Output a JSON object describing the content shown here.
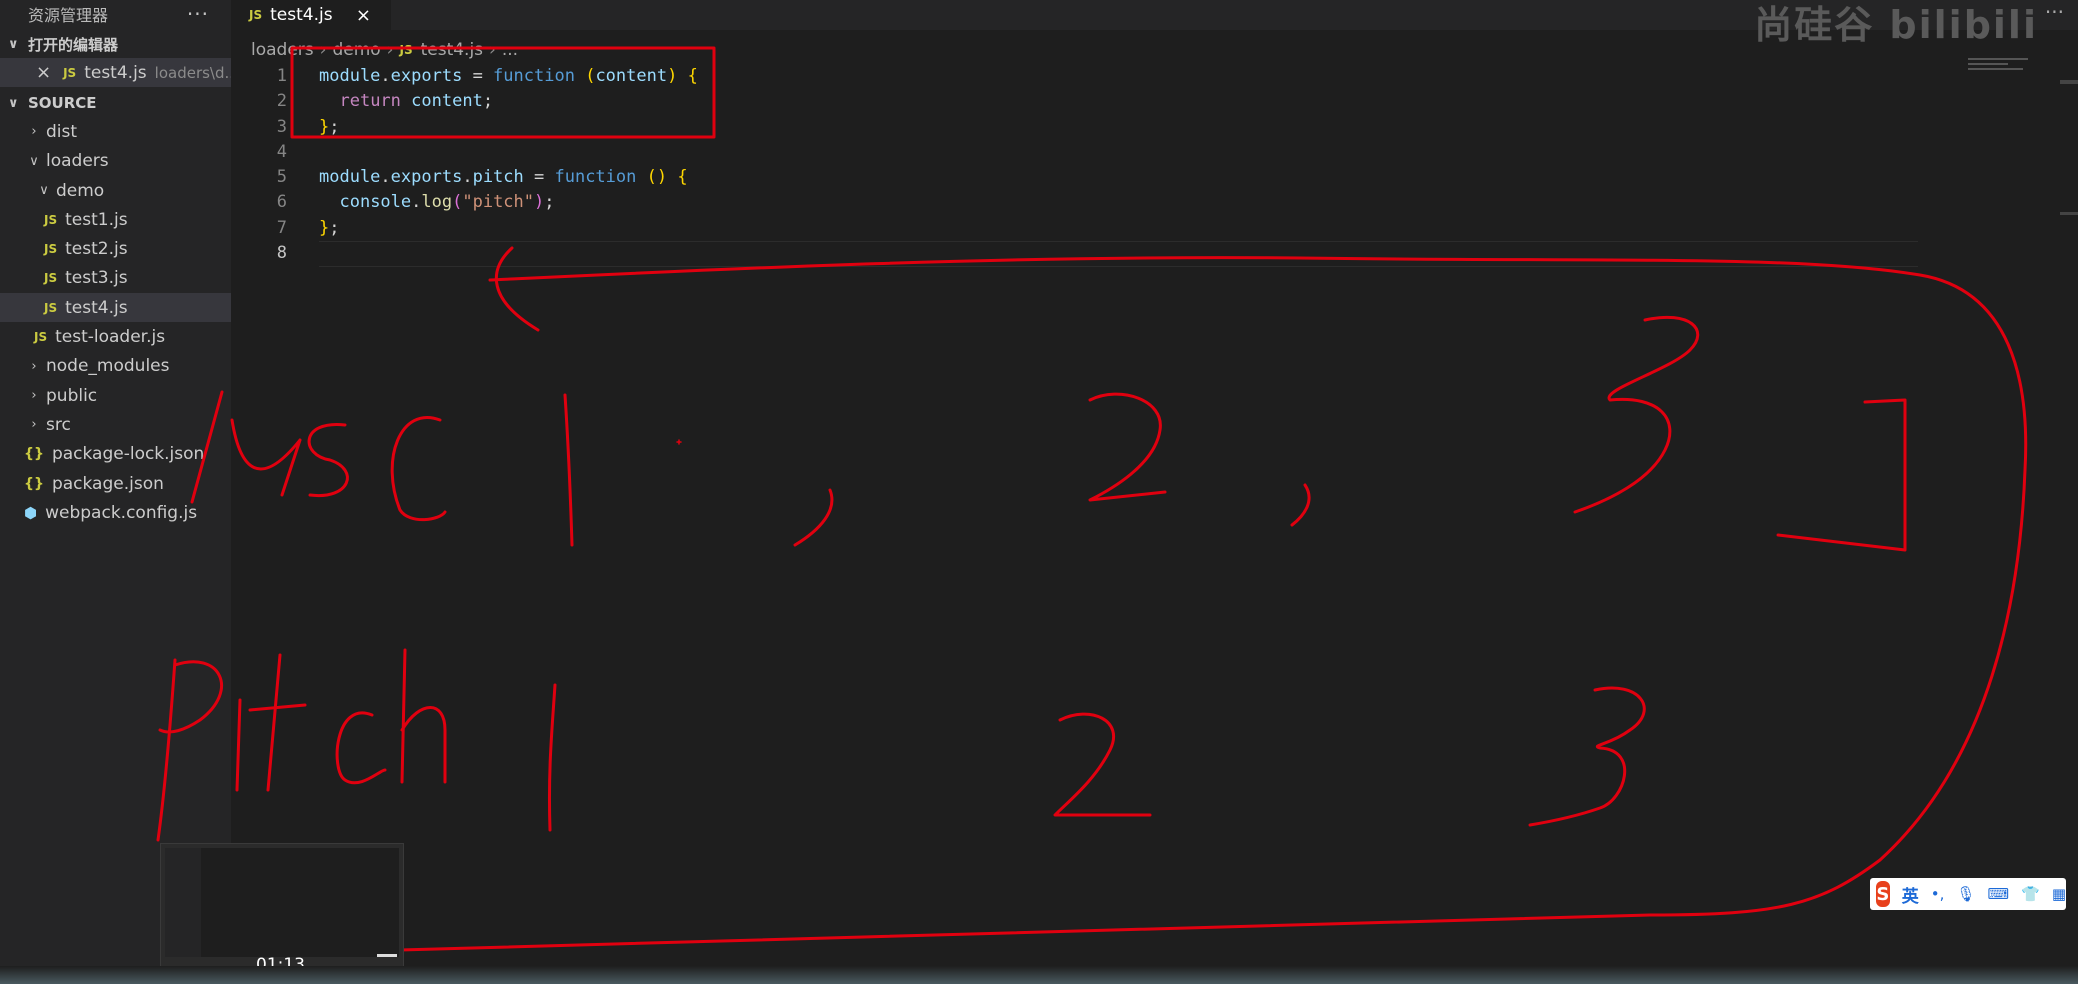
{
  "sidebar": {
    "title": "资源管理器",
    "more": "···",
    "open_editors_label": "打开的编辑器",
    "open_editor": {
      "name": "test4.js",
      "path": "loaders\\d..."
    },
    "project_label": "SOURCE",
    "tree": [
      {
        "label": "dist",
        "kind": "folder",
        "state": "collapsed",
        "depth": 1
      },
      {
        "label": "loaders",
        "kind": "folder",
        "state": "expanded",
        "depth": 1
      },
      {
        "label": "demo",
        "kind": "folder",
        "state": "expanded",
        "depth": 2
      },
      {
        "label": "test1.js",
        "kind": "js",
        "depth": 3
      },
      {
        "label": "test2.js",
        "kind": "js",
        "depth": 3
      },
      {
        "label": "test3.js",
        "kind": "js",
        "depth": 3
      },
      {
        "label": "test4.js",
        "kind": "js",
        "depth": 3,
        "selected": true
      },
      {
        "label": "test-loader.js",
        "kind": "js",
        "depth": 2
      },
      {
        "label": "node_modules",
        "kind": "folder",
        "state": "collapsed",
        "depth": 1
      },
      {
        "label": "public",
        "kind": "folder",
        "state": "collapsed",
        "depth": 1
      },
      {
        "label": "src",
        "kind": "folder",
        "state": "collapsed",
        "depth": 1
      },
      {
        "label": "package-lock.json",
        "kind": "json",
        "depth": 1
      },
      {
        "label": "package.json",
        "kind": "json",
        "depth": 1
      },
      {
        "label": "webpack.config.js",
        "kind": "webpack",
        "depth": 1
      }
    ]
  },
  "tab": {
    "label": "test4.js",
    "icon": "JS"
  },
  "watermark": "尚硅谷 bilibili",
  "breadcrumb": [
    "loaders",
    "demo",
    "test4.js",
    "..."
  ],
  "editor": {
    "line_numbers": [
      "1",
      "2",
      "3",
      "4",
      "5",
      "6",
      "7",
      "8"
    ],
    "lines": [
      [
        [
          "module",
          "k-var"
        ],
        [
          ".",
          "k-op"
        ],
        [
          "exports",
          "k-var"
        ],
        [
          " = ",
          "k-op"
        ],
        [
          "function",
          "k-fn"
        ],
        [
          " ",
          "k-op"
        ],
        [
          "(",
          "k-br"
        ],
        [
          "content",
          "k-var"
        ],
        [
          ")",
          "k-br"
        ],
        [
          " ",
          "k-op"
        ],
        [
          "{",
          "k-br"
        ]
      ],
      [
        [
          "  ",
          "k-op"
        ],
        [
          "return",
          "k-ret"
        ],
        [
          " ",
          "k-op"
        ],
        [
          "content",
          "k-var"
        ],
        [
          ";",
          "k-op"
        ]
      ],
      [
        [
          "}",
          "k-br"
        ],
        [
          ";",
          "k-op"
        ]
      ],
      [],
      [
        [
          "module",
          "k-var"
        ],
        [
          ".",
          "k-op"
        ],
        [
          "exports",
          "k-var"
        ],
        [
          ".",
          "k-op"
        ],
        [
          "pitch",
          "k-var"
        ],
        [
          " = ",
          "k-op"
        ],
        [
          "function",
          "k-fn"
        ],
        [
          " ",
          "k-op"
        ],
        [
          "()",
          "k-br"
        ],
        [
          " ",
          "k-op"
        ],
        [
          "{",
          "k-br"
        ]
      ],
      [
        [
          "  ",
          "k-op"
        ],
        [
          "console",
          "k-var"
        ],
        [
          ".",
          "k-op"
        ],
        [
          "log",
          "k-call"
        ],
        [
          "(",
          "k-br2"
        ],
        [
          "\"pitch\"",
          "k-str"
        ],
        [
          ")",
          "k-br2"
        ],
        [
          ";",
          "k-op"
        ]
      ],
      [
        [
          "}",
          "k-br"
        ],
        [
          ";",
          "k-op"
        ]
      ],
      []
    ]
  },
  "annotation": {
    "row1_label": "use",
    "row1_items": [
      "1",
      "2",
      "3"
    ],
    "row2_label": "pitch",
    "row2_items": [
      "1",
      "2",
      "3"
    ],
    "color": "#e0000f"
  },
  "video": {
    "time": "01:13"
  },
  "ime": {
    "logo": "S",
    "lang": "英"
  },
  "colors": {
    "sidebar_bg": "#252526",
    "editor_bg": "#1e1e1e",
    "ink": "#e0000f"
  }
}
